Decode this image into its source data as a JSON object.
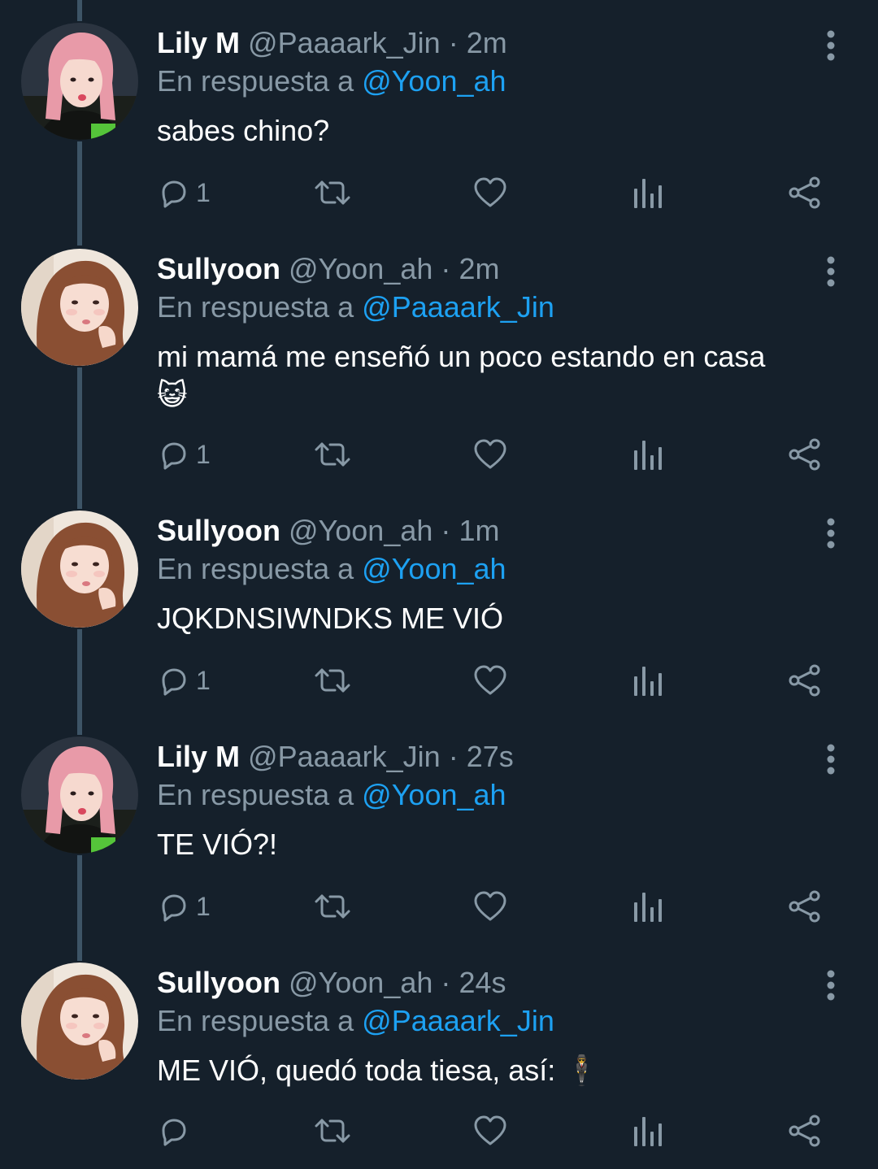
{
  "reply_prefix": "En respuesta a",
  "tweets": [
    {
      "name": "Lily M",
      "handle": "@Paaaark_Jin",
      "sep": "·",
      "time": "2m",
      "reply_to": "@Yoon_ah",
      "text": "sabes chino?",
      "reply_count": "1",
      "avatar": "pink-hair-avatar"
    },
    {
      "name": "Sullyoon",
      "handle": "@Yoon_ah",
      "sep": "·",
      "time": "2m",
      "reply_to": "@Paaaark_Jin",
      "text": "mi mamá me enseñó un poco estando en casa\n😺",
      "reply_count": "1",
      "avatar": "brown-hair-avatar"
    },
    {
      "name": "Sullyoon",
      "handle": "@Yoon_ah",
      "sep": "·",
      "time": "1m",
      "reply_to": "@Yoon_ah",
      "text": "JQKDNSIWNDKS ME VIÓ",
      "reply_count": "1",
      "avatar": "brown-hair-avatar"
    },
    {
      "name": "Lily M",
      "handle": "@Paaaark_Jin",
      "sep": "·",
      "time": "27s",
      "reply_to": "@Yoon_ah",
      "text": "TE VIÓ?!",
      "reply_count": "1",
      "avatar": "pink-hair-avatar"
    },
    {
      "name": "Sullyoon",
      "handle": "@Yoon_ah",
      "sep": "·",
      "time": "24s",
      "reply_to": "@Paaaark_Jin",
      "text": "ME VIÓ, quedó toda tiesa, así: 🕴",
      "reply_count": "",
      "avatar": "brown-hair-avatar"
    }
  ],
  "colors": {
    "background": "#15202b",
    "thread_line": "#3d5466",
    "muted": "#8899a6",
    "link": "#1da1f2"
  },
  "icons": [
    "reply-icon",
    "retweet-icon",
    "like-icon",
    "analytics-icon",
    "share-icon",
    "more-vertical-icon"
  ]
}
